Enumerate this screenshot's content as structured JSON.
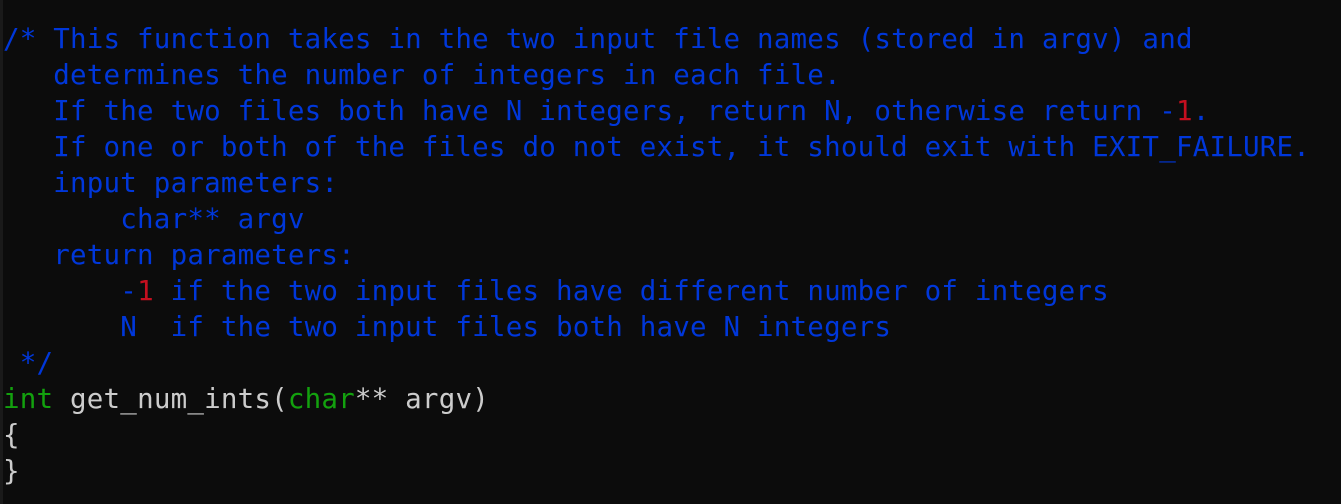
{
  "editor": {
    "lines": [
      [
        {
          "t": "/* This function takes in the two input file names (stored in argv) and",
          "c": "cm"
        }
      ],
      [
        {
          "t": "   determines the number of integers in each file.",
          "c": "cm"
        }
      ],
      [
        {
          "t": "   If the two files both have N integers, return N, otherwise return -",
          "c": "cm"
        },
        {
          "t": "1",
          "c": "num"
        },
        {
          "t": ".",
          "c": "cm"
        }
      ],
      [
        {
          "t": "   If one or both of the files do not exist, it should exit with EXIT_FAILURE.",
          "c": "cm"
        }
      ],
      [
        {
          "t": "   input parameters:",
          "c": "cm"
        }
      ],
      [
        {
          "t": "       char** argv",
          "c": "cm"
        }
      ],
      [
        {
          "t": "   return parameters:",
          "c": "cm"
        }
      ],
      [
        {
          "t": "       -",
          "c": "cm"
        },
        {
          "t": "1",
          "c": "num"
        },
        {
          "t": " if the two input files have different number of integers",
          "c": "cm"
        }
      ],
      [
        {
          "t": "       N  if the two input files both have N integers",
          "c": "cm"
        }
      ],
      [
        {
          "t": " */",
          "c": "cm"
        }
      ],
      [
        {
          "t": "int",
          "c": "kw"
        },
        {
          "t": " get_num_ints(",
          "c": "tx"
        },
        {
          "t": "char",
          "c": "kw"
        },
        {
          "t": "** argv)",
          "c": "tx"
        }
      ],
      [
        {
          "t": "{",
          "c": "tx"
        }
      ],
      [
        {
          "t": "}",
          "c": "tx"
        }
      ]
    ]
  }
}
